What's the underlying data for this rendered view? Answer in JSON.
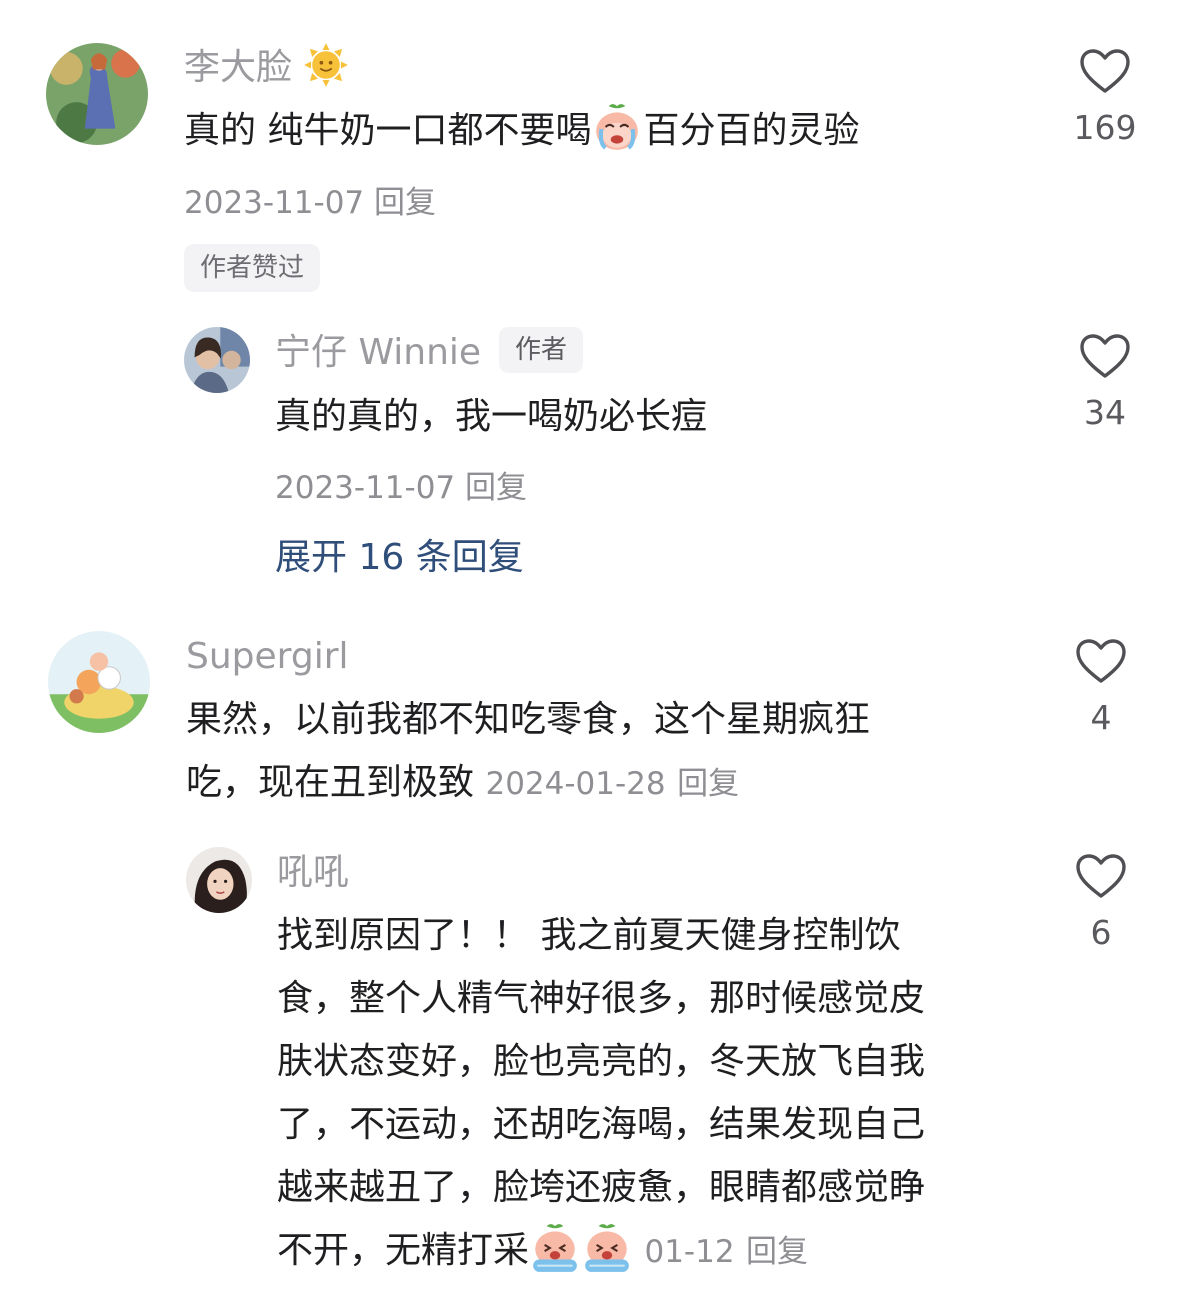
{
  "comments": [
    {
      "username": "李大脸",
      "text_before_emoji": "真的 纯牛奶一口都不要喝",
      "text_after_emoji": "百分百的灵验",
      "date": "2023-11-07",
      "reply_label": "回复",
      "liked_by_author_label": "作者赞过",
      "like_count": "169",
      "emoji_icon": "crying-peach-emoji",
      "name_icon": "sun-emoji"
    },
    {
      "username": "宁仔 Winnie",
      "author_badge": "作者",
      "text": "真的真的，我一喝奶必长痘",
      "date": "2023-11-07",
      "reply_label": "回复",
      "like_count": "34",
      "expand_label": "展开 16 条回复"
    },
    {
      "username": "Supergirl",
      "text_line1": "果然，以前我都不知吃零食，这个星期疯狂",
      "text_line2": "吃，现在丑到极致",
      "date": "2024-01-28",
      "reply_label": "回复",
      "like_count": "4"
    },
    {
      "username": "吼吼",
      "lines": [
        "找到原因了！！ 我之前夏天健身控制饮",
        "食，整个人精气神好很多，那时候感觉皮",
        "肤状态变好，脸也亮亮的，冬天放飞自我",
        "了，不运动，还胡吃海喝，结果发现自己",
        "越来越丑了，脸垮还疲惫，眼睛都感觉睁"
      ],
      "last_line": "不开，无精打采",
      "date": "01-12",
      "reply_label": "回复",
      "like_count": "6",
      "emoji_icon": "sobbing-peach-emoji"
    }
  ],
  "colors": {
    "name": "#9b9b9f",
    "text": "#1f1f22",
    "meta": "#8e8e93",
    "link": "#2f4e7a",
    "tag_bg": "#f3f3f5"
  },
  "icons": {
    "like": "heart-outline-icon"
  }
}
